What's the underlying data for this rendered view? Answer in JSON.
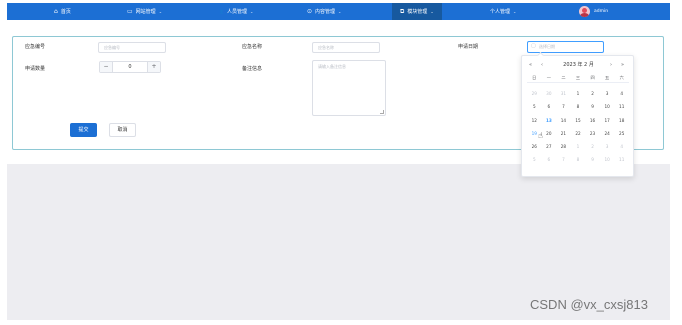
{
  "navbar": {
    "items": [
      {
        "label": "首页",
        "icon": "home-icon",
        "glyph": "⌂",
        "caret": ""
      },
      {
        "label": "网站管理",
        "icon": "monitor-icon",
        "glyph": "▭",
        "caret": "⌄"
      },
      {
        "label": "人员管理",
        "icon": "user-icon",
        "glyph": "👤",
        "caret": "⌄"
      },
      {
        "label": "内容管理",
        "icon": "check-circle-icon",
        "glyph": "⊙",
        "caret": "⌄"
      },
      {
        "label": "模块管理",
        "icon": "copy-icon",
        "glyph": "⧉",
        "caret": "⌄"
      },
      {
        "label": "个人管理",
        "icon": "",
        "glyph": "",
        "caret": "⌄"
      }
    ],
    "username": "admin",
    "bg_color": "#1c6fd4",
    "active_color": "#17599f"
  },
  "form": {
    "field1_label": "应急编号",
    "field1_placeholder": "应急编号",
    "field2_label": "应急名称",
    "field2_placeholder": "应急名称",
    "field3_label": "申请日期",
    "field3_placeholder": "选择日期",
    "field4_label": "申请数量",
    "field4_value": "0",
    "field5_label": "备注信息",
    "field5_placeholder": "请输入备注信息",
    "submit_label": "提交",
    "cancel_label": "取消"
  },
  "datepicker": {
    "prev_year": "«",
    "prev_month": "‹",
    "next_month": "›",
    "next_year": "»",
    "title": "2023 年 2 月",
    "weekdays": [
      "日",
      "一",
      "二",
      "三",
      "四",
      "五",
      "六"
    ],
    "days": [
      [
        "29",
        "30",
        "31",
        "1",
        "2",
        "3",
        "4"
      ],
      [
        "5",
        "6",
        "7",
        "8",
        "9",
        "10",
        "11"
      ],
      [
        "12",
        "13",
        "14",
        "15",
        "16",
        "17",
        "18"
      ],
      [
        "19",
        "20",
        "21",
        "22",
        "23",
        "24",
        "25"
      ],
      [
        "26",
        "27",
        "28",
        "1",
        "2",
        "3",
        "4"
      ],
      [
        "5",
        "6",
        "7",
        "8",
        "9",
        "10",
        "11"
      ]
    ],
    "today": "13",
    "hovered": "19"
  },
  "watermark": "CSDN @vx_cxsj813"
}
